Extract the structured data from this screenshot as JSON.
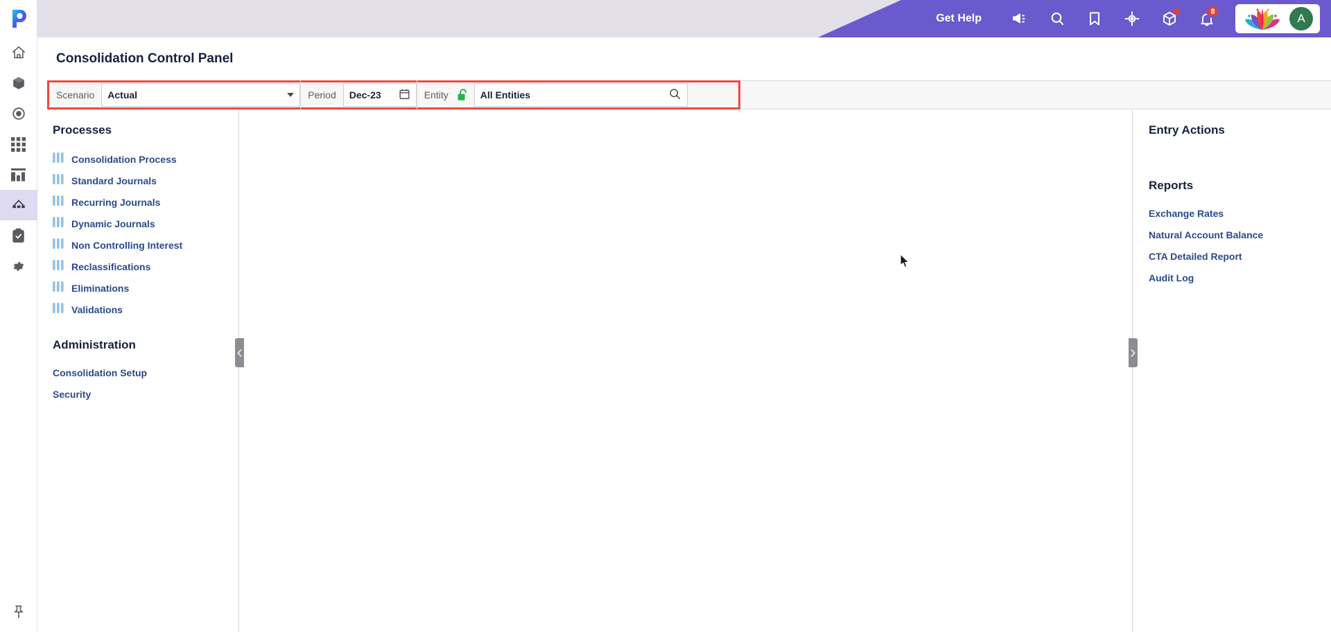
{
  "app": {
    "logo_icon": "p-logo-icon"
  },
  "icon_rail": {
    "items": [
      {
        "icon": "home-icon",
        "name": "home",
        "active": false
      },
      {
        "icon": "cube-icon",
        "name": "models",
        "active": false
      },
      {
        "icon": "target-icon",
        "name": "targets",
        "active": false
      },
      {
        "icon": "grid-icon",
        "name": "grid",
        "active": false
      },
      {
        "icon": "bar-chart-icon",
        "name": "reports",
        "active": false
      },
      {
        "icon": "hierarchy-icon",
        "name": "consolidation",
        "active": true
      },
      {
        "icon": "clipboard-check-icon",
        "name": "tasks",
        "active": false
      },
      {
        "icon": "gear-icon",
        "name": "settings",
        "active": false
      }
    ],
    "pin_icon": "pushpin-icon"
  },
  "header": {
    "get_help_label": "Get Help",
    "icons": [
      {
        "icon": "megaphone-icon",
        "name": "announcements",
        "badge": false
      },
      {
        "icon": "search-icon",
        "name": "search",
        "badge": false
      },
      {
        "icon": "bookmark-icon",
        "name": "bookmarks",
        "badge": false
      },
      {
        "icon": "crosshair-icon",
        "name": "focus",
        "badge": false
      },
      {
        "icon": "cube-outline-icon",
        "name": "apps",
        "badge": true
      }
    ],
    "notification": {
      "icon": "bell-icon",
      "count": "8"
    },
    "user": {
      "product_logo_icon": "lotus-logo-icon",
      "avatar_initial": "A"
    },
    "accent_purple": "#6a5acd",
    "bar_bg": "#e4e0ea"
  },
  "page": {
    "title": "Consolidation Control Panel"
  },
  "filters": {
    "highlight_color": "#f0483e",
    "scenario": {
      "label": "Scenario",
      "value": "Actual",
      "dropdown_icon": "chevron-down-icon"
    },
    "period": {
      "label": "Period",
      "value": "Dec-23",
      "calendar_icon": "calendar-icon"
    },
    "entity": {
      "label": "Entity",
      "lock_icon": "unlock-icon",
      "lock_color": "#1eb54a",
      "value": "All Entities",
      "search_icon": "search-icon"
    }
  },
  "left_panel": {
    "processes_heading": "Processes",
    "processes": [
      {
        "label": "Consolidation Process",
        "icon": "bars-icon"
      },
      {
        "label": "Standard Journals",
        "icon": "bars-icon"
      },
      {
        "label": "Recurring Journals",
        "icon": "bars-icon"
      },
      {
        "label": "Dynamic Journals",
        "icon": "bars-icon"
      },
      {
        "label": "Non Controlling Interest",
        "icon": "bars-icon"
      },
      {
        "label": "Reclassifications",
        "icon": "bars-icon"
      },
      {
        "label": "Eliminations",
        "icon": "bars-icon"
      },
      {
        "label": "Validations",
        "icon": "bars-icon"
      }
    ],
    "administration_heading": "Administration",
    "administration": [
      {
        "label": "Consolidation Setup"
      },
      {
        "label": "Security"
      }
    ],
    "collapse_icon": "chevron-left-icon"
  },
  "right_panel": {
    "entry_actions_heading": "Entry Actions",
    "reports_heading": "Reports",
    "reports": [
      {
        "label": "Exchange Rates"
      },
      {
        "label": "Natural Account Balance"
      },
      {
        "label": "CTA Detailed Report"
      },
      {
        "label": "Audit Log"
      }
    ],
    "expand_icon": "chevron-right-icon"
  },
  "link_color": "#2b4a8b"
}
